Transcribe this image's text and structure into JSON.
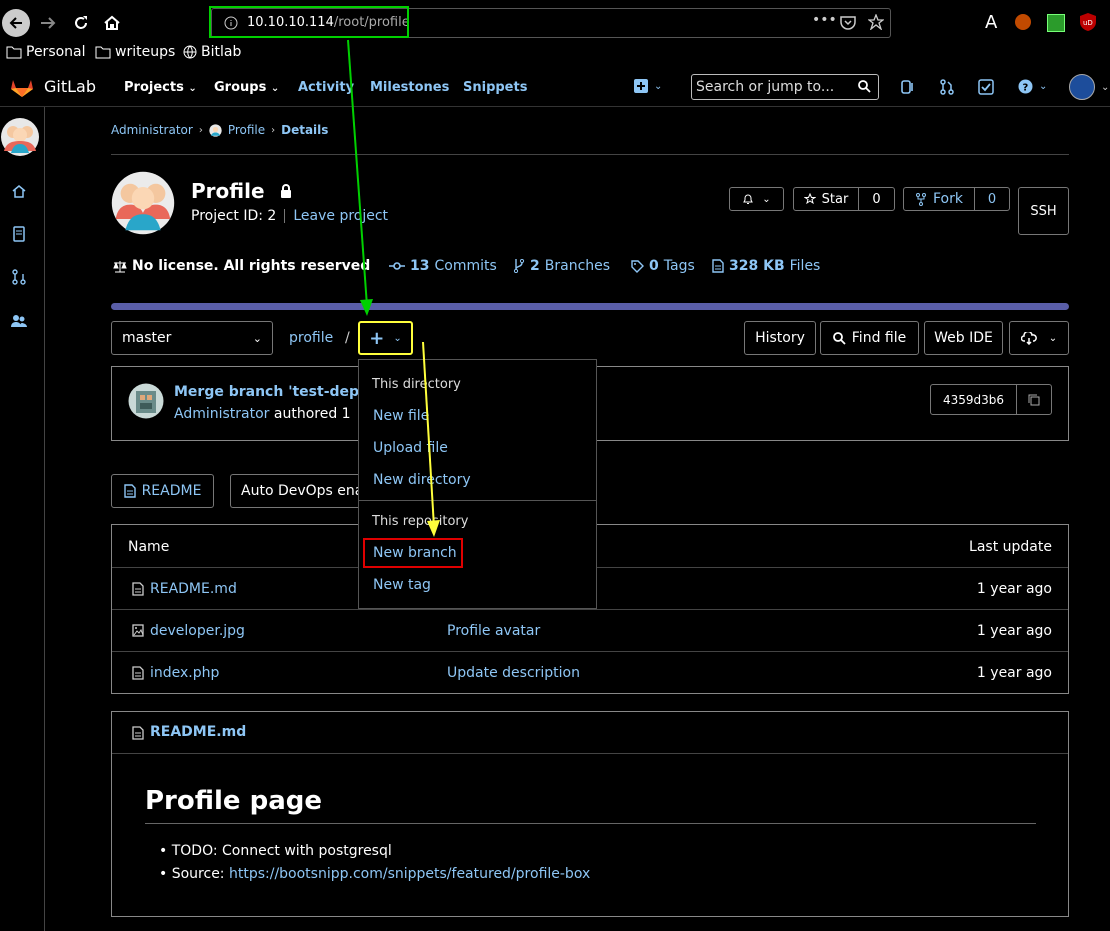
{
  "browser": {
    "url_host": "10.10.10.114",
    "url_path": "/root/profile",
    "reader_letter": "A",
    "bookmarks": [
      "Personal",
      "writeups",
      "Bitlab"
    ]
  },
  "gitlab_header": {
    "brand": "GitLab",
    "nav": [
      "Projects",
      "Groups",
      "Activity",
      "Milestones",
      "Snippets"
    ],
    "search_placeholder": "Search or jump to..."
  },
  "breadcrumb": [
    "Administrator",
    "Profile",
    "Details"
  ],
  "project": {
    "name": "Profile",
    "id_label": "Project ID: 2",
    "leave": "Leave project",
    "star_label": "Star",
    "star_count": "0",
    "fork_label": "Fork",
    "fork_count": "0",
    "ssh": "SSH"
  },
  "stats": {
    "license": "No license. All rights reserved",
    "commits_count": "13",
    "commits_label": "Commits",
    "branches_count": "2",
    "branches_label": "Branches",
    "tags_count": "0",
    "tags_label": "Tags",
    "files_size": "328 KB",
    "files_label": "Files"
  },
  "repo_bar": {
    "branch": "master",
    "path": "profile",
    "slash": "/",
    "history": "History",
    "find_file": "Find file",
    "web_ide": "Web IDE"
  },
  "commit": {
    "title": "Merge branch 'test-dep",
    "author": "Administrator",
    "authored": "authored 1",
    "sha": "4359d3b6"
  },
  "dropdown": {
    "dir_header": "This directory",
    "new_file": "New file",
    "upload_file": "Upload file",
    "new_directory": "New directory",
    "repo_header": "This repository",
    "new_branch": "New branch",
    "new_tag": "New tag"
  },
  "buttons": {
    "readme": "README",
    "autodevops": "Auto DevOps ena"
  },
  "table": {
    "col_name": "Name",
    "col_update": "Last update",
    "rows": [
      {
        "name": "README.md",
        "commit": "",
        "update": "1 year ago"
      },
      {
        "name": "developer.jpg",
        "commit": "Profile avatar",
        "update": "1 year ago"
      },
      {
        "name": "index.php",
        "commit": "Update description",
        "update": "1 year ago"
      }
    ]
  },
  "readme": {
    "filename": "README.md",
    "heading": "Profile page",
    "todo": "TODO: Connect with postgresql",
    "source_label": "Source: ",
    "source_link": "https://bootsnipp.com/snippets/featured/profile-box"
  },
  "colors": {
    "highlight_green": "#00d000",
    "highlight_yellow": "#ffff3c",
    "highlight_red": "#e00000",
    "link_blue": "#8ec6f5"
  }
}
